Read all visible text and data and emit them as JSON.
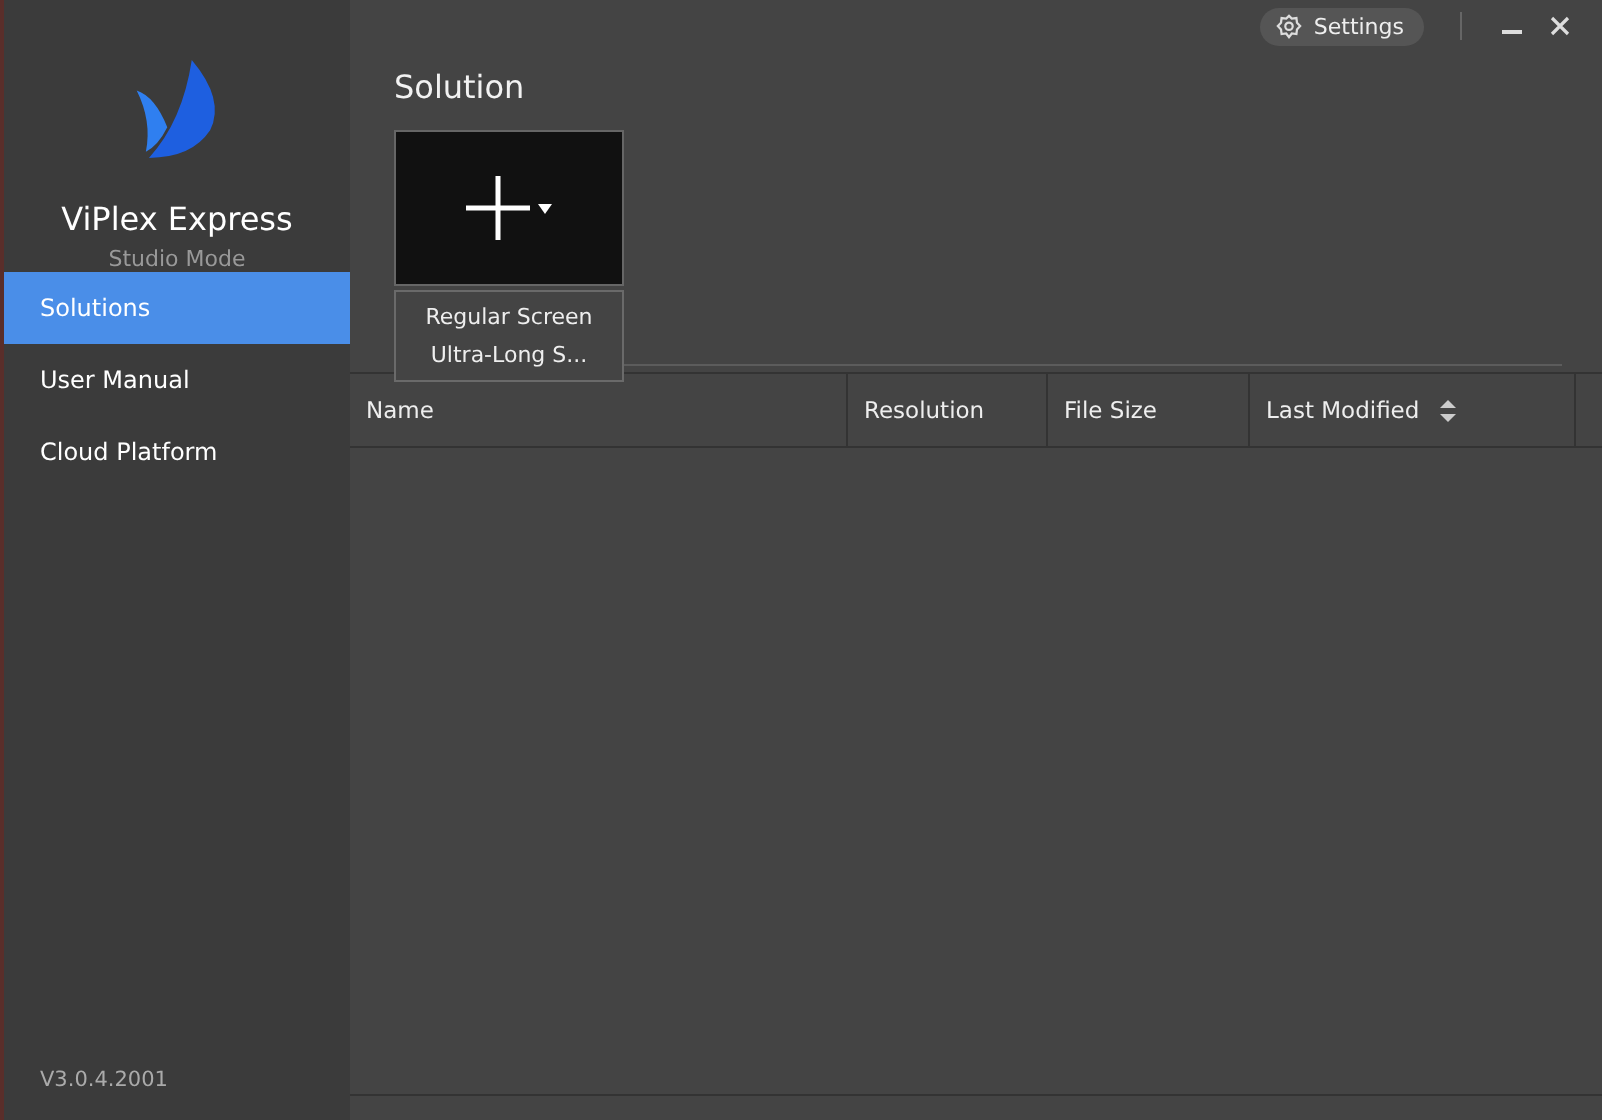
{
  "app": {
    "name": "ViPlex Express",
    "mode": "Studio Mode",
    "version": "V3.0.4.2001"
  },
  "sidebar": {
    "items": [
      {
        "label": "Solutions",
        "selected": true
      },
      {
        "label": "User Manual",
        "selected": false
      },
      {
        "label": "Cloud Platform",
        "selected": false
      }
    ]
  },
  "title_bar": {
    "settings": "Settings"
  },
  "page_title": "Solution",
  "new_menu": {
    "items": [
      "Regular Screen",
      "Ultra-Long S..."
    ]
  },
  "table": {
    "columns": [
      {
        "label": "Name",
        "sortable": false
      },
      {
        "label": "Resolution",
        "sortable": false
      },
      {
        "label": "File Size",
        "sortable": false
      },
      {
        "label": "Last Modified",
        "sortable": true
      }
    ]
  }
}
